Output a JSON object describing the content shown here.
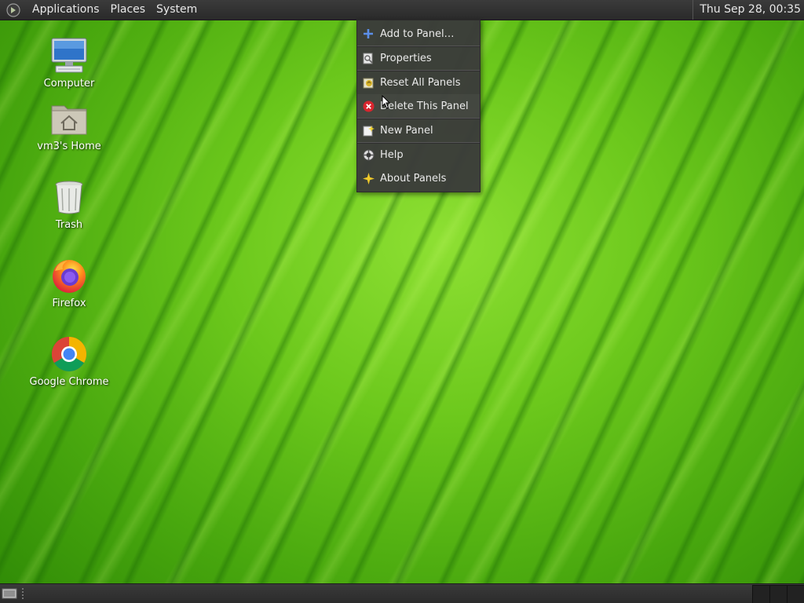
{
  "top_panel": {
    "menus": [
      "Applications",
      "Places",
      "System"
    ],
    "clock": "Thu Sep 28, 00:35"
  },
  "desktop_icons": [
    {
      "label": "Computer",
      "icon": "computer-icon"
    },
    {
      "label": "vm3's Home",
      "icon": "home-folder-icon"
    },
    {
      "label": "Trash",
      "icon": "trash-icon"
    },
    {
      "label": "Firefox",
      "icon": "firefox-icon"
    },
    {
      "label": "Google Chrome",
      "icon": "chrome-icon"
    }
  ],
  "context_menu": {
    "items": [
      {
        "label": "Add to Panel…",
        "icon": "plus-icon"
      },
      {
        "label": "Properties",
        "icon": "properties-icon"
      },
      {
        "label": "Reset All Panels",
        "icon": "reset-icon"
      },
      {
        "label": "Delete This Panel",
        "icon": "delete-icon"
      },
      {
        "label": "New Panel",
        "icon": "new-panel-icon"
      },
      {
        "label": "Help",
        "icon": "help-icon"
      },
      {
        "label": "About Panels",
        "icon": "about-icon"
      }
    ]
  },
  "colors": {
    "panel": "#2f2f2f",
    "menu_bg": "#3a3a3a",
    "wallpaper": "#6cc81c"
  }
}
